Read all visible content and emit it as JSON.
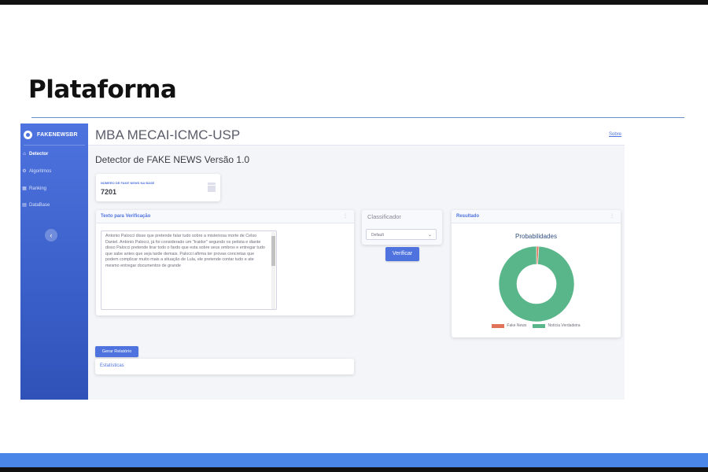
{
  "slide": {
    "title": "Plataforma"
  },
  "sidebar": {
    "brand": "FAKENEWSBR",
    "items": [
      {
        "label": "Detector",
        "icon": "home-icon"
      },
      {
        "label": "Algoritmos",
        "icon": "gear-icon"
      },
      {
        "label": "Ranking",
        "icon": "grid-icon"
      },
      {
        "label": "DataBase",
        "icon": "database-icon"
      }
    ],
    "toggle": "‹"
  },
  "header": {
    "title": "MBA MECAI-ICMC-USP",
    "link": "Sobre"
  },
  "page": {
    "heading": "Detector de FAKE NEWS Versão 1.0"
  },
  "stat_card": {
    "label": "NÚMERO DE FAKE NEWS NA BASE",
    "value": "7201"
  },
  "text_card": {
    "title": "Texto para Verificação",
    "menu": "⋮",
    "content": "Antonio Palocci disse que pretende falar tudo sobre a misteriosa morte de Celso Daniel. Antonio Palocci, já foi considerado um \"traidor\" segundo os petista e diante disso Palocci pretende tirar todo o fardo que esta sobre seus ombros e entregar tudo que sabe antes que seja tarde demais. Palocci afirma ter provas concretas que podem complicar muito mais a situação de Lula, ele pretende contar tudo e ate mesmo entregar documentos de grande"
  },
  "classifier": {
    "label": "Classificador",
    "selected": "Default",
    "button": "Verificar"
  },
  "result_card": {
    "title": "Resultado",
    "menu": "⋮"
  },
  "chart_data": {
    "type": "pie",
    "title": "Probabilidades",
    "categories": [
      "Fake News",
      "Notícia Verdadeira"
    ],
    "values": [
      0.01,
      0.99
    ],
    "colors": [
      "#e0735a",
      "#59b68a"
    ],
    "legend_position": "bottom"
  },
  "report": {
    "button": "Gerar Relatório"
  },
  "stats_card": {
    "title": "Estatísticas"
  },
  "colors": {
    "accent": "#4e73df",
    "sidebar": "#4e73df",
    "slide_bar": "#4a86e8"
  }
}
